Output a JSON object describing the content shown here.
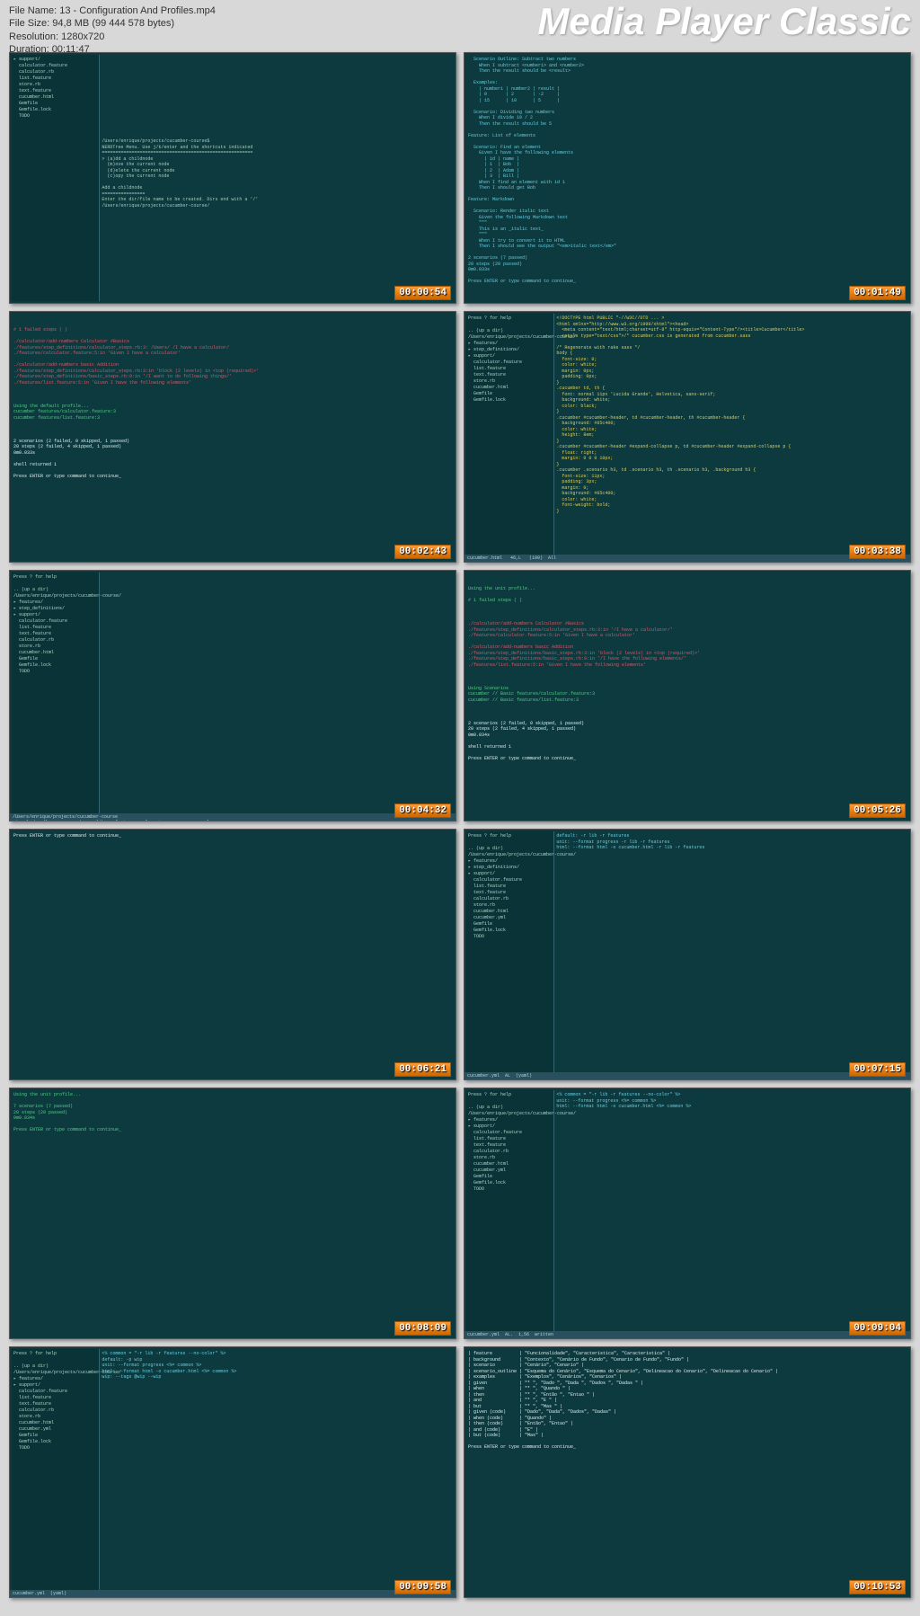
{
  "header": {
    "filename_label": "File Name: 13 - Configuration And Profiles.mp4",
    "filesize_label": "File Size: 94,8 MB (99 444 578 bytes)",
    "resolution_label": "Resolution: 1280x720",
    "duration_label": "Duration: 00:11:47",
    "app_title": "Media Player Classic"
  },
  "thumbnails": [
    {
      "timestamp": "00:00:54",
      "sidebar": "▸ support/\n  calculator.feature\n  calculator.rb\n  list.feature\n  store.rb\n  text.feature\n  cucumber.html\n  Gemfile\n  Gemfile.lock\n  TODO",
      "main": "\n\n\n\n\n\n\n\n\n\n\n\n\n\n/Users/enrique/projects/cucumber-course$ \nNERDTree Menu. Use j/k/enter and the shortcuts indicated\n========================================================\n> (a)dd a childnode\n  (m)ove the current node\n  (d)elete the current node\n  (c)opy the current node\n\nAdd a childnode\n================\nEnter the dir/file name to be created. Dirs end with a '/'\n/Users/enrique/projects/cucumber-course/"
    },
    {
      "timestamp": "00:01:49",
      "main": "  Scenario Outline: Subtract two numbers\n    When I subtract <number1> and <number2>\n    Then the result should be <result>\n\n  Examples:\n    | number1 | number2 | result |\n    | 0       | 2       | -2     |\n    | 15      | 10      | 5      |\n\n  Scenario: Dividing two numbers\n    When I divide 10 / 2\n    Then the result should be 5\n\nFeature: List of elements\n\n  Scenario: Find an element\n    Given I have the following elements\n      | id | name |\n      | 1  | Bob  |\n      | 2  | Adam |\n      | 3  | Bill |\n    When I find an element with id 1\n    Then I should get Bob\n\nFeature: Markdown\n\n  Scenario: Render italic text\n    Given the following Markdown text\n    \"\"\"\n    This is an _italic text_\n    \"\"\"\n    When I try to convert it to HTML\n    Then I should see the output \"<em>italic text</em>\"\n\n2 scenarios (7 passed)\n20 steps (20 passed)\n0m0.033s\n\nPress ENTER or type command to continue_"
    },
    {
      "timestamp": "00:02:43",
      "main_red": "# 1 failed steps ( )\n\n./calculator/add-numbers Calculator #Basics\n./features/step_definitions/calculator_steps.rb:3: /Users/ /I have a calculator/\n./features/calculator.feature:5:in 'Given I have a calculator'\n\n./calculator/add-numbers basic Addition\n./features/step_definitions/calculator_steps.rb:3:in 'block (2 levels) in <top (required)>'\n./features/step_definitions/basic_steps.rb:9:in '/I want to do following things/'\n./features/list.feature:5:in 'Given I have the following elements'",
      "main_green": "\nUsing the default profile...\ncucumber features/calculator.feature:3\ncucumber features/list.feature:3",
      "main_white": "\n2 scenarios (2 failed, 0 skipped, 1 passed)\n20 steps (2 failed, 4 skipped, 1 passed)\n0m0.033s\n\nshell returned 1\n\nPress ENTER or type command to continue_"
    },
    {
      "timestamp": "00:03:38",
      "sidebar": "Press ? for help\n\n.. (up a dir)\n/Users/enrique/projects/cucumber-course/\n▸ features/\n▸ step_definitions/\n▸ support/\n  calculator.feature\n  list.feature\n  text.feature\n  store.rb\n  cucumber.html\n  Gemfile\n  Gemfile.lock",
      "main_html": "<!DOCTYPE html PUBLIC \"-//W3C//DTD ... >\n<html xmlns=\"http://www.w3.org/1999/xhtml\"><head>\n  <meta content=\"text/html;charset=utf-8\" http-equiv=\"Content-Type\"/><title>Cucumber</title>\n  <style type=\"text/css\">/* cucumber.css is generated from cucumber.sass\n\n/* Regenerate with rake sass */\nbody {\n  font-size: 0;\n  color: white;\n  margin: 0px;\n  padding: 0px;\n}\n.cucumber td, th {\n  font: normal 11px 'Lucida Grande', Helvetica, sans-serif;\n  background: white;\n  color: black;\n}\n.cucumber #cucumber-header, td #cucumber-header, th #cucumber-header {\n  background: #65c400;\n  color: white;\n  height: 8em;\n}\n.cucumber #cucumber-header #expand-collapse p, td #cucumber-header #expand-collapse p {\n  float: right;\n  margin: 0 0 0 10px;\n}\n.cucumber .scenario h3, td .scenario h3, th .scenario h3, .background h3 {\n  font-size: 11px;\n  padding: 3px;\n  margin: 0;\n  background: #65c400;\n  color: white;\n  font-weight: bold;\n}",
      "status": "cucumber.html   46,L   (100)  All"
    },
    {
      "timestamp": "00:04:32",
      "sidebar": "Press ? for help\n\n.. (up a dir)\n/Users/enrique/projects/cucumber-course/\n▸ features/\n▸ step_definitions/\n▸ support/\n  calculator.feature\n  list.feature\n  text.feature\n  calculator.rb\n  store.rb\n  cucumber.html\n  Gemfile\n  Gemfile.lock\n  TODO",
      "status": "/Users/enrique/projects/cucumber-course\nvisual: bundle exec cucumber --lib -r features --format progress --no-color_"
    },
    {
      "timestamp": "00:05:26",
      "main_top": "Using the unit profile...\n\n# 1 failed steps ( )",
      "main_red": "\n./calculator/add-numbers Calculator #Basics\n./features/step_definitions/calculator_steps.rb:3:in '/I have a calculator/'\n./features/calculator.feature:5:in 'Given I have a calculator'\n\n./calculator/add-numbers basic Addition\n./features/step_definitions/basic_steps.rb:3:in 'block (2 levels) in <top (required)>'\n./features/step_definitions/basic_steps.rb:9:in '/I have the following elements/'\n./features/list.feature:5:in 'Given I have the following elements'",
      "main_green": "\nUsing Scenarios\ncucumber // Basic features/calculator.feature:3\ncucumber // Basic features/list.feature:3",
      "main_white": "\n2 scenarios (2 failed, 0 skipped, 1 passed)\n20 steps (2 failed, 4 skipped, 1 passed)\n0m0.034s\n\nshell returned 1\n\nPress ENTER or type command to continue_"
    },
    {
      "timestamp": "00:06:21",
      "main": "Press ENTER or type command to continue_"
    },
    {
      "timestamp": "00:07:15",
      "sidebar": "Press ? for help\n\n.. (up a dir)\n/Users/enrique/projects/cucumber-course/\n▸ features/\n▸ step_definitions/\n▸ support/\n  calculator.feature\n  list.feature\n  text.feature\n  calculator.rb\n  store.rb\n  cucumber.html\n  cucumber.yml\n  Gemfile\n  Gemfile.lock\n  TODO",
      "main": "default: -r lib -r features\nunit: --format progress -r lib -r features\nhtml: --format html -o cucumber.html -r lib -r features",
      "status": "cucumber.yml  AL  (yaml)"
    },
    {
      "timestamp": "00:08:09",
      "main": "Using the unit profile...\n\n7 scenarios (7 passed)\n20 steps (20 passed)\n0m0.034s\n\nPress ENTER or type command to continue_"
    },
    {
      "timestamp": "00:09:04",
      "sidebar": "Press ? for help\n\n.. (up a dir)\n/Users/enrique/projects/cucumber-course/\n▸ features/\n▸ support/\n  calculator.feature\n  list.feature\n  text.feature\n  calculator.rb\n  store.rb\n  cucumber.html\n  cucumber.yml\n  Gemfile\n  Gemfile.lock\n  TODO",
      "main": "<% common = \"-r lib -r features --no-color\" %>\nunit: --format progress <%= common %>\nhtml: --format html -o cucumber.html <%= common %>",
      "status": "cucumber.yml  AL.  1,56  written"
    },
    {
      "timestamp": "00:09:58",
      "sidebar": "Press ? for help\n\n.. (up a dir)\n/Users/enrique/projects/cucumber-course/\n▸ features/\n▸ support/\n  calculator.feature\n  list.feature\n  text.feature\n  calculator.rb\n  store.rb\n  cucumber.html\n  cucumber.yml\n  Gemfile\n  Gemfile.lock\n  TODO",
      "main": "<% common = \"-r lib -r features --no-color\" %>\ndefault: -p wip\nunit: --format progress <%= common %>\nhtml: --format html -o cucumber.html <%= common %>\nwip: --tags @wip --wip",
      "status": "cucumber.yml  (yaml)"
    },
    {
      "timestamp": "00:10:53",
      "main": "| feature          | \"Funcionalidade\", \"Característica\", \"Caracteristica\" |\n| background       | \"Contexto\", \"Cenário de Fundo\", \"Cenario de Fundo\", \"Fundo\" |\n| scenario         | \"Cenário\", \"Cenario\" |\n| scenario_outline | \"Esquema do Cenário\", \"Esquema do Cenario\", \"Delineacao do Cenario\", \"Delineacao do Cenario\" |\n| examples         | \"Exemplos\", \"Cenários\", \"Cenarios\" |\n| given            | \"* \", \"Dado \", \"Dada \", \"Dados \", \"Dadas \" |\n| when             | \"* \", \"Quando \" |\n| then             | \"* \", \"Então \", \"Entao \" |\n| and              | \"* \", \"E \" |\n| but              | \"* \", \"Mas \" |\n| given (code)     | \"Dado\", \"Dada\", \"Dados\", \"Dadas\" |\n| when (code)      | \"Quando\" |\n| then (code)      | \"Então\", \"Entao\" |\n| and (code)       | \"E\" |\n| but (code)       | \"Mas\" |\n\nPress ENTER or type command to continue_"
    }
  ]
}
